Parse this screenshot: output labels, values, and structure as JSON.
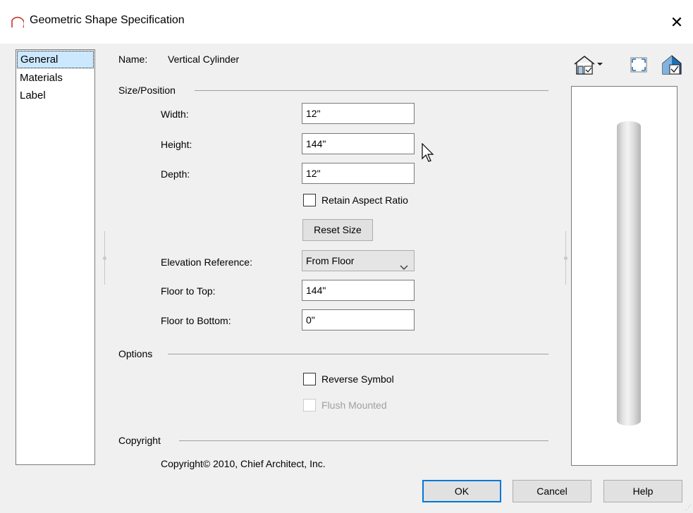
{
  "window": {
    "title": "Geometric Shape Specification",
    "close_glyph": "✕"
  },
  "pages": [
    {
      "label": "General",
      "selected": true
    },
    {
      "label": "Materials",
      "selected": false
    },
    {
      "label": "Label",
      "selected": false
    }
  ],
  "general": {
    "name_label": "Name:",
    "name_value": "Vertical Cylinder",
    "size_position": {
      "heading": "Size/Position",
      "width_label": "Width:",
      "width_value": "12\"",
      "height_label": "Height:",
      "height_value": "144\"",
      "depth_label": "Depth:",
      "depth_value": "12\"",
      "retain_aspect_label": "Retain Aspect Ratio",
      "retain_aspect_checked": false,
      "reset_size_label": "Reset Size",
      "elevation_ref_label": "Elevation Reference:",
      "elevation_ref_value": "From Floor",
      "floor_to_top_label": "Floor to Top:",
      "floor_to_top_value": "144\"",
      "floor_to_bottom_label": "Floor to Bottom:",
      "floor_to_bottom_value": "0\""
    },
    "options": {
      "heading": "Options",
      "reverse_symbol_label": "Reverse Symbol",
      "reverse_symbol_checked": false,
      "flush_mounted_label": "Flush Mounted",
      "flush_mounted_checked": false,
      "flush_mounted_enabled": false
    },
    "copyright": {
      "heading": "Copyright",
      "text": "Copyright© 2010, Chief Architect, Inc."
    }
  },
  "preview_toolbar": {
    "icons": [
      "render-view-icon",
      "fill-window-icon",
      "preview-mode-icon"
    ]
  },
  "buttons": {
    "ok": "OK",
    "cancel": "Cancel",
    "help": "Help"
  },
  "colors": {
    "accent": "#0078d7",
    "selection": "#cce8ff",
    "title_icon": "#c0392b"
  }
}
